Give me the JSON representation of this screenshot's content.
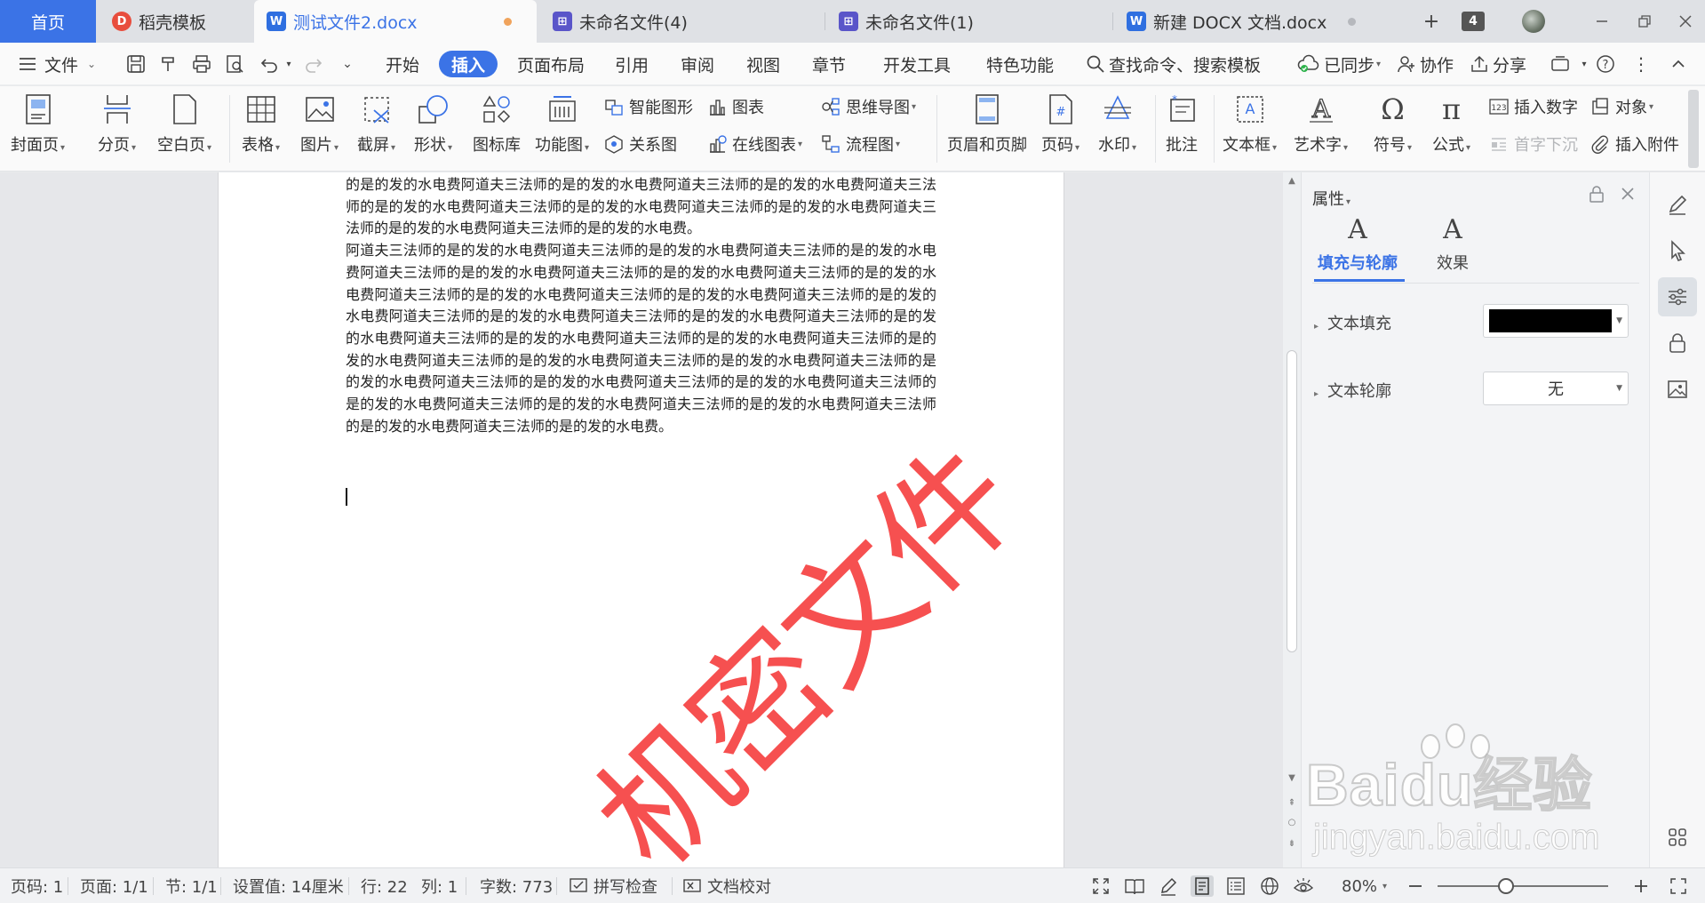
{
  "tabs": {
    "home": "首页",
    "items": [
      {
        "label": "稻壳模板"
      },
      {
        "label": "测试文件2.docx"
      },
      {
        "label": "未命名文件(4)"
      },
      {
        "label": "未命名文件(1)"
      },
      {
        "label": "新建 DOCX 文档.docx"
      }
    ],
    "add": "+",
    "count": "4"
  },
  "menubar": {
    "file": "文件",
    "tabs": [
      "开始",
      "插入",
      "页面布局",
      "引用",
      "审阅",
      "视图",
      "章节",
      "开发工具",
      "特色功能"
    ],
    "active_tab": "插入",
    "search": "查找命令、搜索模板",
    "sync": "已同步",
    "collab": "协作",
    "share": "分享"
  },
  "ribbon": {
    "cover": "封面页",
    "page_break": "分页",
    "blank_page": "空白页",
    "table": "表格",
    "picture": "图片",
    "screenshot": "截屏",
    "shape": "形状",
    "icon_lib": "图标库",
    "func_chart": "功能图",
    "smart_shape": "智能图形",
    "chart": "图表",
    "mind_map": "思维导图",
    "relation": "关系图",
    "online_chart": "在线图表",
    "flowchart": "流程图",
    "header_footer": "页眉和页脚",
    "page_num": "页码",
    "watermark": "水印",
    "comment": "批注",
    "textbox": "文本框",
    "wordart": "艺术字",
    "symbol": "符号",
    "formula": "公式",
    "insert_number": "插入数字",
    "object": "对象",
    "drop_cap": "首字下沉",
    "attachment": "插入附件"
  },
  "document": {
    "paragraphs": [
      "的是的发的水电费阿道夫三法师的是的发的水电费阿道夫三法师的是的发的水电费阿道夫三法师的是的发的水电费阿道夫三法师的是的发的水电费阿道夫三法师的是的发的水电费阿道夫三法师的是的发的水电费阿道夫三法师的是的发的水电费。",
      "阿道夫三法师的是的发的水电费阿道夫三法师的是的发的水电费阿道夫三法师的是的发的水电费阿道夫三法师的是的发的水电费阿道夫三法师的是的发的水电费阿道夫三法师的是的发的水电费阿道夫三法师的是的发的水电费阿道夫三法师的是的发的水电费阿道夫三法师的是的发的水电费阿道夫三法师的是的发的水电费阿道夫三法师的是的发的水电费阿道夫三法师的是的发的水电费阿道夫三法师的是的发的水电费阿道夫三法师的是的发的水电费阿道夫三法师的是的发的水电费阿道夫三法师的是的发的水电费阿道夫三法师的是的发的水电费阿道夫三法师的是的发的水电费阿道夫三法师的是的发的水电费阿道夫三法师的是的发的水电费阿道夫三法师的是的发的水电费阿道夫三法师的是的发的水电费阿道夫三法师的是的发的水电费阿道夫三法师的是的发的水电费阿道夫三法师的是的发的水电费。"
    ],
    "watermark_text": "机密文件",
    "watermark_color": "#f65050"
  },
  "properties": {
    "title": "属性",
    "tab_fill": "填充与轮廓",
    "tab_effect": "效果",
    "text_fill_label": "文本填充",
    "text_fill_color": "#000000",
    "text_outline_label": "文本轮廓",
    "text_outline_value": "无"
  },
  "status": {
    "page_num": "页码: 1",
    "pages": "页面: 1/1",
    "section": "节: 1/1",
    "setting": "设置值: 14厘米",
    "row": "行: 22",
    "col": "列: 1",
    "word_count": "字数: 773",
    "spell_check": "拼写检查",
    "doc_check": "文档校对",
    "zoom": "80%",
    "zoom_level": 0.4
  },
  "overlay": {
    "brand_main": "Baidu经验",
    "brand_url": "jingyan.baidu.com"
  },
  "colors": {
    "accent": "#3b73e6",
    "home_tab": "#3b73e6"
  }
}
